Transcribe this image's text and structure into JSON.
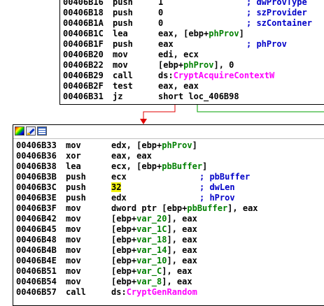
{
  "block1": {
    "lines": [
      {
        "addr": "00406B16",
        "mn": "push",
        "ops": "1",
        "cmt": "; dwProvType"
      },
      {
        "addr": "00406B18",
        "mn": "push",
        "ops": "0",
        "cmt": "; szProvider"
      },
      {
        "addr": "00406B1A",
        "mn": "push",
        "ops": "0",
        "cmt": "; szContainer"
      },
      {
        "addr": "00406B1C",
        "mn": "lea",
        "ops_parts": [
          {
            "t": "eax, [ebp+"
          },
          {
            "t": "phProv",
            "c": "v"
          },
          {
            "t": "]"
          }
        ]
      },
      {
        "addr": "00406B1F",
        "mn": "push",
        "ops": "eax",
        "cmt": "; phProv"
      },
      {
        "addr": "00406B20",
        "mn": "mov",
        "ops": "edi, ecx"
      },
      {
        "addr": "00406B22",
        "mn": "mov",
        "ops_parts": [
          {
            "t": "[ebp+"
          },
          {
            "t": "phProv",
            "c": "v"
          },
          {
            "t": "], 0"
          }
        ]
      },
      {
        "addr": "00406B29",
        "mn": "call",
        "ops_parts": [
          {
            "t": "ds:"
          },
          {
            "t": "CryptAcquireContextW",
            "c": "f"
          }
        ]
      },
      {
        "addr": "00406B2F",
        "mn": "test",
        "ops": "eax, eax"
      },
      {
        "addr": "00406B31",
        "mn": "jz",
        "ops": "short loc_406B98"
      }
    ]
  },
  "block2": {
    "toolbar": [
      "graph-overview-icon",
      "edit-icon",
      "list-view-icon"
    ],
    "lines": [
      {
        "addr": "00406B33",
        "mn": "mov",
        "ops_parts": [
          {
            "t": "edx, [ebp+"
          },
          {
            "t": "phProv",
            "c": "v"
          },
          {
            "t": "]"
          }
        ]
      },
      {
        "addr": "00406B36",
        "mn": "xor",
        "ops": "eax, eax"
      },
      {
        "addr": "00406B38",
        "mn": "lea",
        "ops_parts": [
          {
            "t": "ecx, [ebp+"
          },
          {
            "t": "pbBuffer",
            "c": "v"
          },
          {
            "t": "]"
          }
        ]
      },
      {
        "addr": "00406B3B",
        "mn": "push",
        "ops": "ecx",
        "cmt": "; pbBuffer"
      },
      {
        "addr": "00406B3C",
        "mn": "push",
        "ops_parts": [
          {
            "t": "32",
            "c": "hl"
          }
        ],
        "cmt": "; dwLen"
      },
      {
        "addr": "00406B3E",
        "mn": "push",
        "ops": "edx",
        "cmt": "; hProv"
      },
      {
        "addr": "00406B3F",
        "mn": "mov",
        "ops_parts": [
          {
            "t": "dword ptr [ebp+"
          },
          {
            "t": "pbBuffer",
            "c": "v"
          },
          {
            "t": "], eax"
          }
        ]
      },
      {
        "addr": "00406B42",
        "mn": "mov",
        "ops_parts": [
          {
            "t": "[ebp+"
          },
          {
            "t": "var_20",
            "c": "v"
          },
          {
            "t": "], eax"
          }
        ]
      },
      {
        "addr": "00406B45",
        "mn": "mov",
        "ops_parts": [
          {
            "t": "[ebp+"
          },
          {
            "t": "var_1C",
            "c": "v"
          },
          {
            "t": "], eax"
          }
        ]
      },
      {
        "addr": "00406B48",
        "mn": "mov",
        "ops_parts": [
          {
            "t": "[ebp+"
          },
          {
            "t": "var_18",
            "c": "v"
          },
          {
            "t": "], eax"
          }
        ]
      },
      {
        "addr": "00406B4B",
        "mn": "mov",
        "ops_parts": [
          {
            "t": "[ebp+"
          },
          {
            "t": "var_14",
            "c": "v"
          },
          {
            "t": "], eax"
          }
        ]
      },
      {
        "addr": "00406B4E",
        "mn": "mov",
        "ops_parts": [
          {
            "t": "[ebp+"
          },
          {
            "t": "var_10",
            "c": "v"
          },
          {
            "t": "], eax"
          }
        ]
      },
      {
        "addr": "00406B51",
        "mn": "mov",
        "ops_parts": [
          {
            "t": "[ebp+"
          },
          {
            "t": "var_C",
            "c": "v"
          },
          {
            "t": "], eax"
          }
        ]
      },
      {
        "addr": "00406B54",
        "mn": "mov",
        "ops_parts": [
          {
            "t": "[ebp+"
          },
          {
            "t": "var_8",
            "c": "v"
          },
          {
            "t": "], eax"
          }
        ]
      },
      {
        "addr": "00406B57",
        "mn": "call",
        "ops_parts": [
          {
            "t": "ds:"
          },
          {
            "t": "CryptGenRandom",
            "c": "f"
          }
        ]
      }
    ]
  },
  "colors": {
    "false_edge": "#e00000",
    "true_edge": "#00a000",
    "comment": "#0000c8",
    "variable": "#008000",
    "function": "#ff00ff",
    "highlight": "#f2f20c"
  }
}
